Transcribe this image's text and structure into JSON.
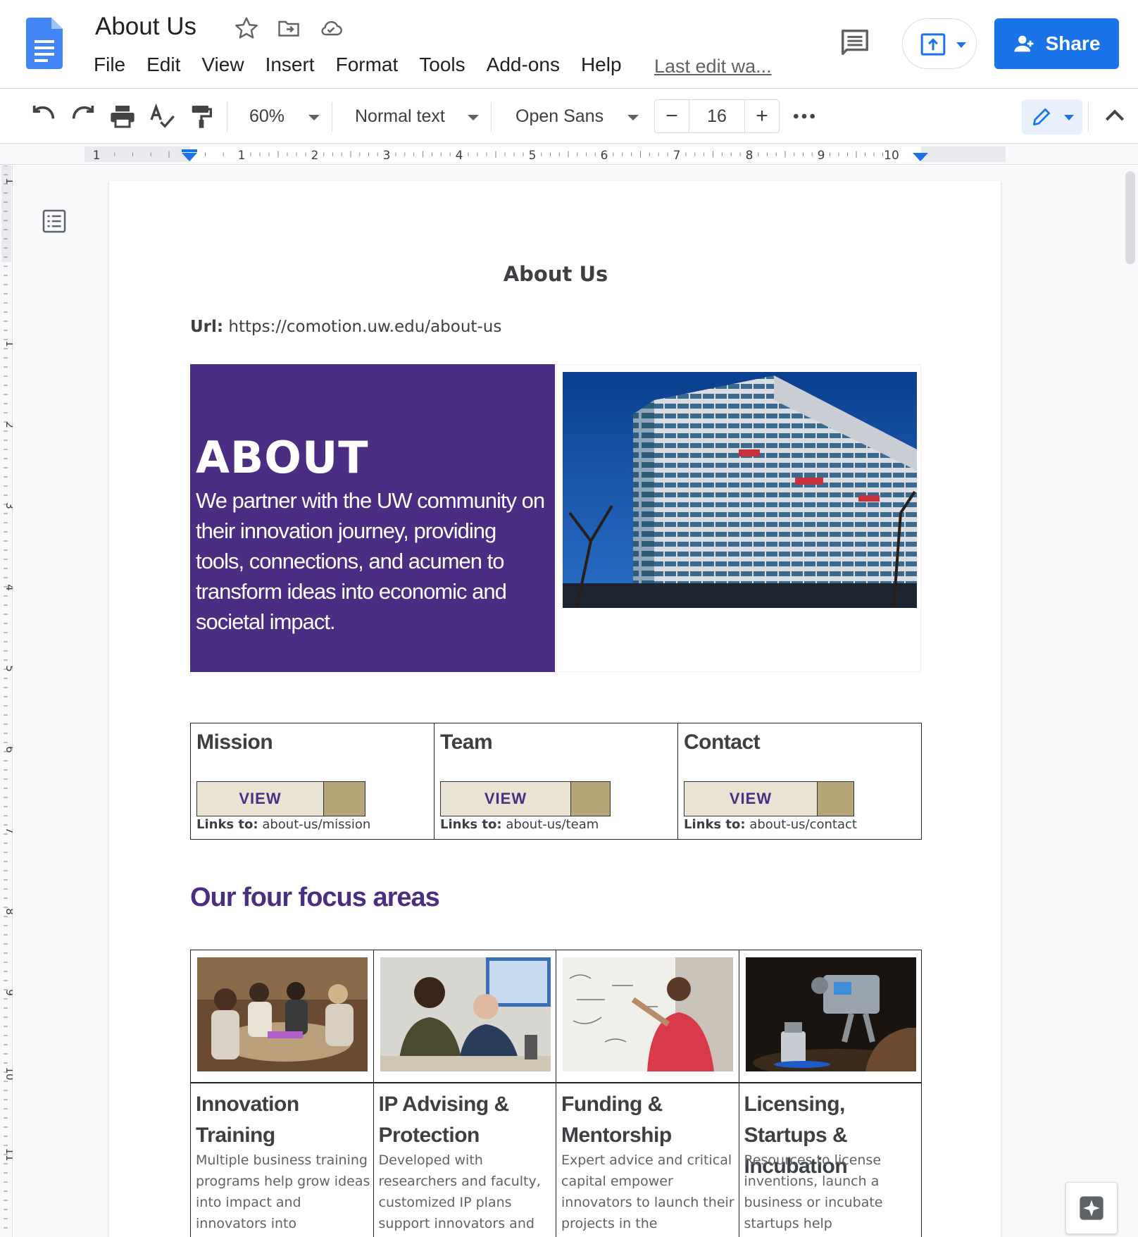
{
  "app": {
    "doc_title": "About Us",
    "menu": [
      "File",
      "Edit",
      "View",
      "Insert",
      "Format",
      "Tools",
      "Add-ons",
      "Help"
    ],
    "last_edit": "Last edit wa...",
    "share_label": "Share",
    "colors": {
      "accent": "#1a73e8",
      "docs_blue": "#4285f4",
      "uw_purple": "#4b2e83",
      "uw_gold": "#b7a57a"
    }
  },
  "toolbar": {
    "zoom": "60%",
    "style": "Normal text",
    "font": "Open Sans",
    "font_size": "16",
    "icons": [
      "undo-icon",
      "redo-icon",
      "print-icon",
      "spellcheck-icon",
      "paint-format-icon",
      "more-icon",
      "edit-mode-icon",
      "collapse-icon"
    ]
  },
  "ruler": {
    "h_labels": [
      "1",
      "1",
      "2",
      "3",
      "4",
      "5",
      "6",
      "7",
      "8",
      "9",
      "10"
    ],
    "v_labels": [
      "1",
      "1",
      "2",
      "3",
      "4",
      "5",
      "6",
      "7",
      "8",
      "9",
      "10",
      "11"
    ]
  },
  "doc": {
    "heading": "About Us",
    "url_label": "Url:",
    "url_value": "https://comotion.uw.edu/about-us",
    "hero": {
      "title": "ABOUT",
      "text": "We partner with the UW community on their innovation journey, providing tools, connections, and acumen to transform ideas into economic and societal impact.",
      "image_icon": "building-photo"
    },
    "nav": [
      {
        "title": "Mission",
        "button": "VIEW",
        "links_label": "Links to:",
        "link": "about-us/mission"
      },
      {
        "title": "Team",
        "button": "VIEW",
        "links_label": "Links to:",
        "link": "about-us/team"
      },
      {
        "title": "Contact",
        "button": "VIEW",
        "links_label": "Links to:",
        "link": "about-us/contact"
      }
    ],
    "focus_heading": "Our four focus areas",
    "focus": [
      {
        "title": "Innovation Training",
        "desc": "Multiple business training programs help grow ideas into impact and innovators into entrepreneurs.",
        "image_icon": "group-meeting-photo"
      },
      {
        "title": "IP Advising & Protection",
        "desc": "Developed with researchers and faculty, customized IP plans support innovators and",
        "image_icon": "advising-photo"
      },
      {
        "title": "Funding & Mentorship",
        "desc": "Expert advice and critical capital empower innovators to launch their projects in the",
        "image_icon": "whiteboard-photo"
      },
      {
        "title": "Licensing, Startups & Incubation",
        "desc": "Resources to license inventions, launch a business or incubate startups help",
        "image_icon": "robot-hand-photo"
      }
    ]
  }
}
